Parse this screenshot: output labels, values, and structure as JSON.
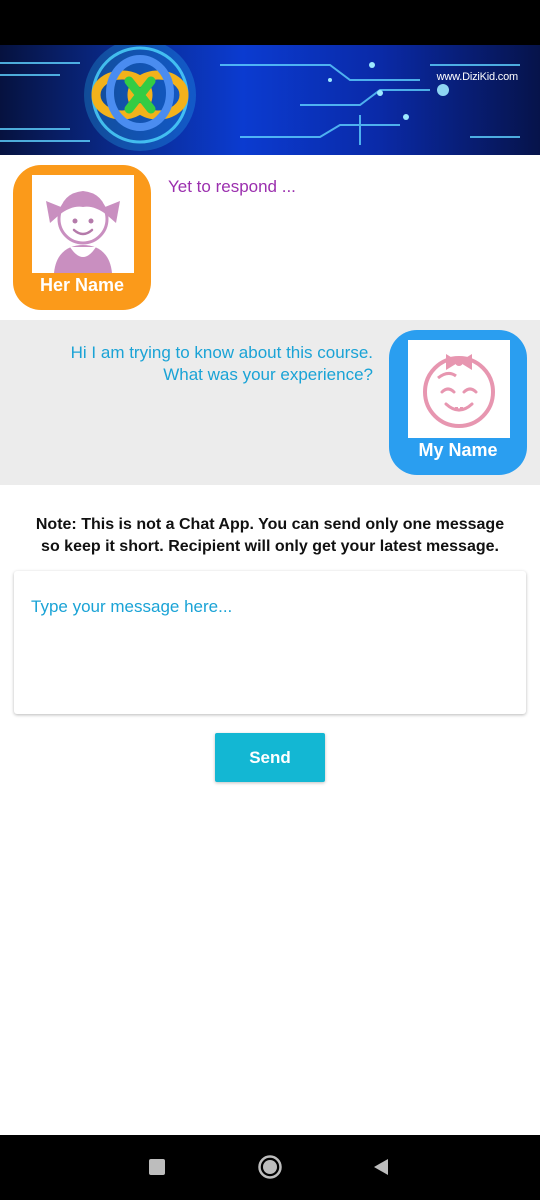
{
  "banner": {
    "url_text": "www.DiziKid.com"
  },
  "recipient": {
    "name": "Her Name",
    "status": "Yet to respond ..."
  },
  "sender": {
    "name": "My Name",
    "message_line1": "Hi I am trying to know about this course.",
    "message_line2": "What was your experience?"
  },
  "note": {
    "line1": "Note: This is not a Chat App. You can send only one message",
    "line2": "so keep it short. Recipient will only get your latest message."
  },
  "compose": {
    "placeholder": "Type your message here...",
    "value": ""
  },
  "send_label": "Send",
  "colors": {
    "her_card": "#fb9a1a",
    "my_card": "#2a9ef0",
    "status_text": "#9b2fae",
    "message_text": "#1aa3d6",
    "send_button": "#13b7d3"
  },
  "nav_icons": [
    "recent-apps-icon",
    "home-icon",
    "back-icon"
  ]
}
